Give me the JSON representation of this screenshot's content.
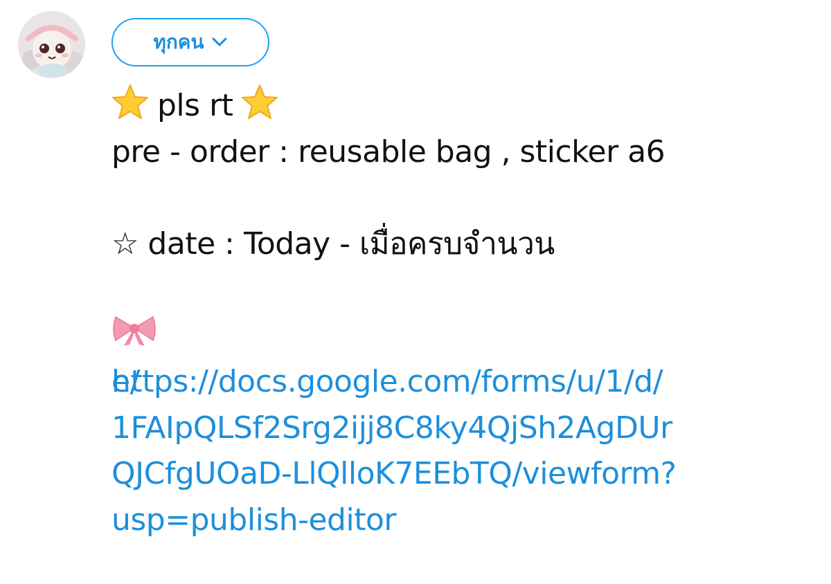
{
  "audience": {
    "label": "ทุกคน"
  },
  "tweet": {
    "line1_text": "pls rt",
    "line2": "pre - order : reusable bag , sticker a6",
    "line3": "☆ date : Today - เมื่อครบจำนวน",
    "link_lines": [
      "https://docs.google.com/forms/u/1/d/",
      "e/",
      "1FAIpQLSf2Srg2ijj8C8ky4QjSh2AgDUr",
      "QJCfgUOaD-LlQlloK7EEbTQ/viewform?",
      "usp=publish-editor"
    ]
  },
  "icons": {
    "avatar": "avatar-image",
    "chevron": "chevron-down-icon",
    "star": "star-emoji-icon",
    "ribbon": "ribbon-emoji-icon"
  },
  "colors": {
    "accent": "#1da1f2",
    "link": "#1d8fdb",
    "text": "#111111"
  }
}
